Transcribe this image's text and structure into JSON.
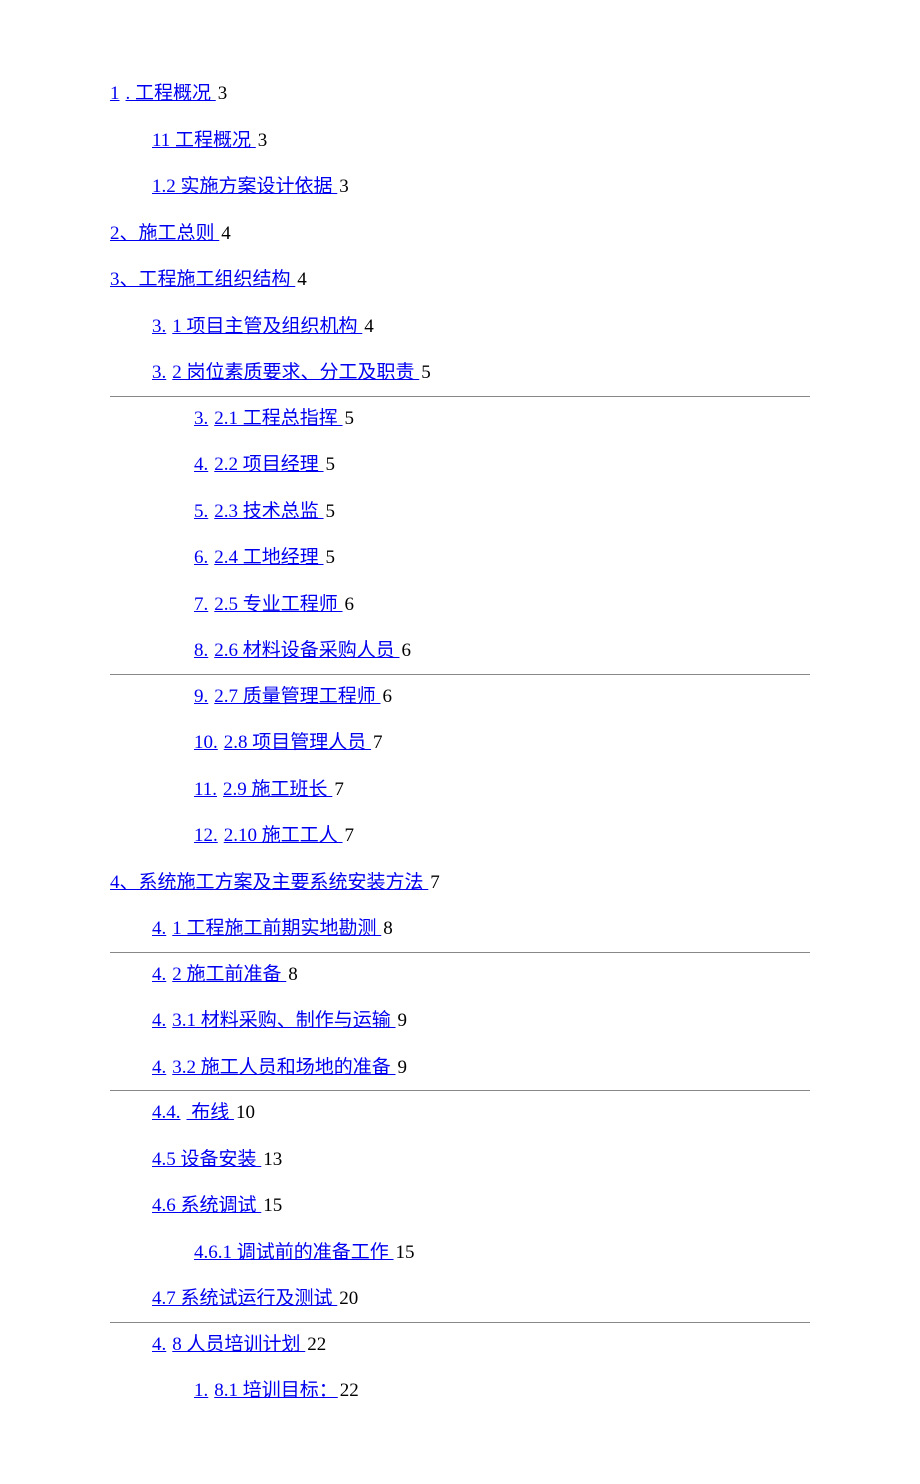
{
  "toc": [
    {
      "indent": 0,
      "prefix": "1",
      "text": ". 工程概况 ",
      "page": "3",
      "hr_after": false
    },
    {
      "indent": 1,
      "prefix": "",
      "text": "11 工程概况 ",
      "page": "3",
      "hr_after": false
    },
    {
      "indent": 1,
      "prefix": "",
      "text": "1.2 实施方案设计依据 ",
      "page": "3",
      "hr_after": false
    },
    {
      "indent": 0,
      "prefix": "",
      "text": "2、施工总则 ",
      "page": "4",
      "hr_after": false
    },
    {
      "indent": 0,
      "prefix": "",
      "text": "3、工程施工组织结构 ",
      "page": "4",
      "hr_after": false
    },
    {
      "indent": 1,
      "prefix": "3.",
      "text": "1 项目主管及组织机构 ",
      "page": "4",
      "hr_after": false
    },
    {
      "indent": 1,
      "prefix": "3.",
      "text": "2 岗位素质要求、分工及职责 ",
      "page": "5",
      "hr_after": true
    },
    {
      "indent": 2,
      "prefix": "3.",
      "text": "2.1 工程总指挥 ",
      "page": "5",
      "hr_after": false
    },
    {
      "indent": 2,
      "prefix": "4.",
      "text": "2.2 项目经理 ",
      "page": "5",
      "hr_after": false
    },
    {
      "indent": 2,
      "prefix": "5.",
      "text": "2.3 技术总监 ",
      "page": "5",
      "hr_after": false
    },
    {
      "indent": 2,
      "prefix": "6.",
      "text": "2.4 工地经理 ",
      "page": "5",
      "hr_after": false
    },
    {
      "indent": 2,
      "prefix": "7.",
      "text": "2.5 专业工程师 ",
      "page": "6",
      "hr_after": false
    },
    {
      "indent": 2,
      "prefix": "8.",
      "text": "2.6 材料设备采购人员 ",
      "page": "6",
      "hr_after": true
    },
    {
      "indent": 2,
      "prefix": "9.",
      "text": "2.7 质量管理工程师 ",
      "page": "6",
      "hr_after": false
    },
    {
      "indent": 2,
      "prefix": "10.",
      "text": "2.8 项目管理人员 ",
      "page": "7",
      "hr_after": false
    },
    {
      "indent": 2,
      "prefix": "11.",
      "text": "2.9 施工班长 ",
      "page": "7",
      "hr_after": false
    },
    {
      "indent": 2,
      "prefix": "12.",
      "text": "2.10 施工工人 ",
      "page": "7",
      "hr_after": false
    },
    {
      "indent": 0,
      "prefix": "",
      "text": "4、系统施工方案及主要系统安装方法 ",
      "page": "7",
      "hr_after": false
    },
    {
      "indent": 1,
      "prefix": "4.",
      "text": "1 工程施工前期实地勘测 ",
      "page": "8",
      "hr_after": true
    },
    {
      "indent": 1,
      "prefix": "4.",
      "text": "2 施工前准备 ",
      "page": "8",
      "hr_after": false
    },
    {
      "indent": 1,
      "prefix": "4.",
      "text": "3.1 材料采购、制作与运输 ",
      "page": "9",
      "hr_after": false
    },
    {
      "indent": 1,
      "prefix": "4.",
      "text": "3.2 施工人员和场地的准备 ",
      "page": "9",
      "hr_after": true
    },
    {
      "indent": 1,
      "prefix": "4.4.",
      "text": "  布线 ",
      "page": "10",
      "hr_after": false
    },
    {
      "indent": 1,
      "prefix": "",
      "text": "4.5 设备安装 ",
      "page": "13",
      "hr_after": false
    },
    {
      "indent": 1,
      "prefix": "",
      "text": "4.6 系统调试 ",
      "page": "15",
      "hr_after": false
    },
    {
      "indent": 2,
      "prefix": "",
      "text": "4.6.1 调试前的准备工作 ",
      "page": "15",
      "hr_after": false
    },
    {
      "indent": 1,
      "prefix": "",
      "text": "4.7 系统试运行及测试 ",
      "page": "20",
      "hr_after": true
    },
    {
      "indent": 1,
      "prefix": "4.",
      "text": "8 人员培训计划 ",
      "page": "22",
      "hr_after": false
    },
    {
      "indent": 2,
      "prefix": "1.",
      "text": "8.1 培训目标：",
      "page": "22",
      "hr_after": false
    }
  ]
}
